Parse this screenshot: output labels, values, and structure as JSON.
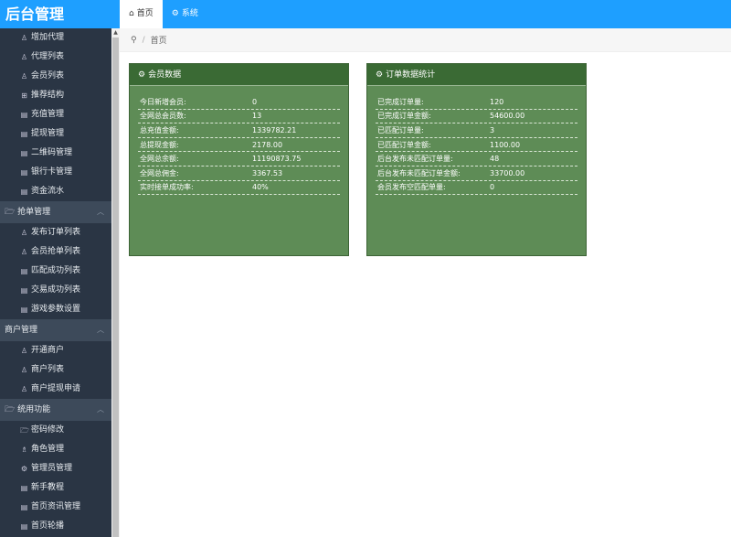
{
  "app": {
    "title": "后台管理"
  },
  "top_tabs": [
    {
      "label": "首页",
      "icon": "home-icon"
    },
    {
      "label": "系统",
      "icon": "gear-icon"
    }
  ],
  "sidebar": {
    "group1_items": [
      {
        "label": "增加代理",
        "icon": "user-icon"
      },
      {
        "label": "代理列表",
        "icon": "user-icon"
      },
      {
        "label": "会员列表",
        "icon": "user-icon"
      },
      {
        "label": "推荐结构",
        "icon": "grid-icon"
      },
      {
        "label": "充值管理",
        "icon": "doc-icon"
      },
      {
        "label": "提现管理",
        "icon": "doc-icon"
      },
      {
        "label": "二维码管理",
        "icon": "doc-icon"
      },
      {
        "label": "银行卡管理",
        "icon": "doc-icon"
      },
      {
        "label": "资金流水",
        "icon": "doc-icon"
      }
    ],
    "group2": {
      "label": "抢单管理",
      "icon": "folder-icon"
    },
    "group2_items": [
      {
        "label": "发布订单列表",
        "icon": "user-icon"
      },
      {
        "label": "会员抢单列表",
        "icon": "user-icon"
      },
      {
        "label": "匹配成功列表",
        "icon": "doc-icon"
      },
      {
        "label": "交易成功列表",
        "icon": "doc-icon"
      },
      {
        "label": "游戏参数设置",
        "icon": "doc-icon"
      }
    ],
    "group3": {
      "label": "商户管理",
      "icon": ""
    },
    "group3_items": [
      {
        "label": "开通商户",
        "icon": "user-icon"
      },
      {
        "label": "商户列表",
        "icon": "user-icon"
      },
      {
        "label": "商户提现申请",
        "icon": "user-icon"
      }
    ],
    "group4": {
      "label": "统用功能",
      "icon": "folder-icon"
    },
    "group4_items": [
      {
        "label": "密码修改",
        "icon": "folder-icon"
      },
      {
        "label": "角色管理",
        "icon": "users-icon"
      },
      {
        "label": "管理员管理",
        "icon": "gear-icon"
      },
      {
        "label": "新手教程",
        "icon": "doc-icon"
      },
      {
        "label": "首页资讯管理",
        "icon": "doc-icon"
      },
      {
        "label": "首页轮播",
        "icon": "doc-icon"
      }
    ]
  },
  "breadcrumb": {
    "home": "首页",
    "sep": "/"
  },
  "panel_member": {
    "title": "会员数据",
    "rows": [
      {
        "k": "今日新增会员:",
        "v": "0"
      },
      {
        "k": "全网总会员数:",
        "v": "13"
      },
      {
        "k": "总充值金额:",
        "v": "1339782.21"
      },
      {
        "k": "总提现金额:",
        "v": "2178.00"
      },
      {
        "k": "全网总余额:",
        "v": "11190873.75"
      },
      {
        "k": "全网总佣金:",
        "v": "3367.53"
      },
      {
        "k": "实时接单成功率:",
        "v": "40%"
      }
    ]
  },
  "panel_order": {
    "title": "订单数据统计",
    "rows": [
      {
        "k": "已完成订单量:",
        "v": "120"
      },
      {
        "k": "已完成订单金额:",
        "v": "54600.00"
      },
      {
        "k": "已匹配订单量:",
        "v": "3"
      },
      {
        "k": "已匹配订单金额:",
        "v": "1100.00"
      },
      {
        "k": "后台发布未匹配订单量:",
        "v": "48"
      },
      {
        "k": "后台发布未匹配订单金额:",
        "v": "33700.00"
      },
      {
        "k": "会员发布空匹配单量:",
        "v": "0"
      }
    ]
  }
}
